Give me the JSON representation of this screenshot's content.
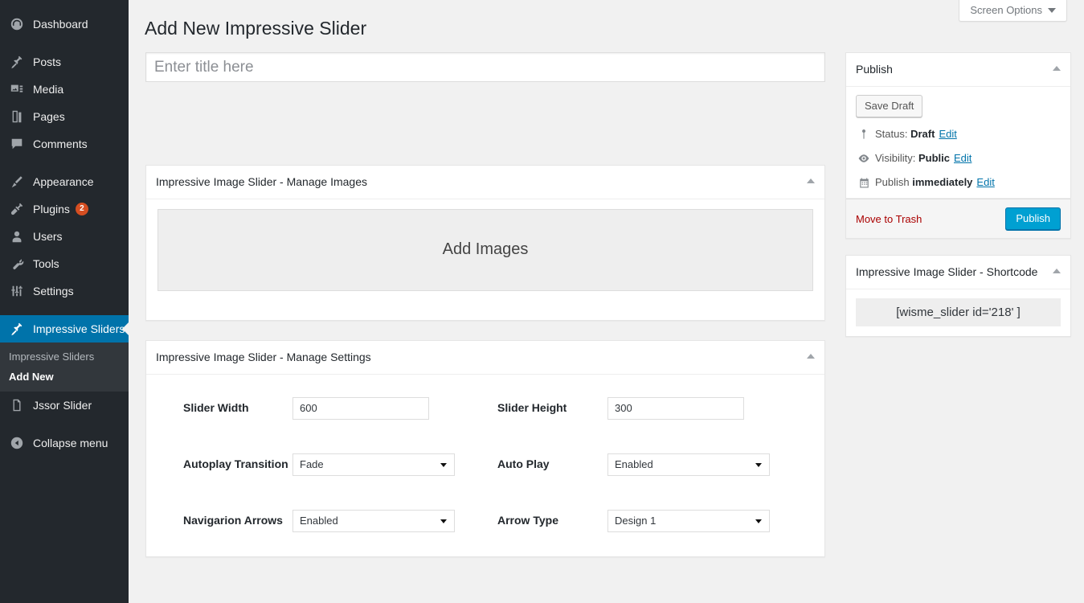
{
  "sidebar": {
    "items": [
      {
        "label": "Dashboard",
        "icon": "dashboard-icon",
        "name": "dashboard"
      },
      {
        "label": "Posts",
        "icon": "pin-icon",
        "name": "posts"
      },
      {
        "label": "Media",
        "icon": "media-icon",
        "name": "media"
      },
      {
        "label": "Pages",
        "icon": "pages-icon",
        "name": "pages"
      },
      {
        "label": "Comments",
        "icon": "comments-icon",
        "name": "comments"
      },
      {
        "label": "Appearance",
        "icon": "brush-icon",
        "name": "appearance"
      },
      {
        "label": "Plugins",
        "icon": "plug-icon",
        "name": "plugins",
        "badge": "2"
      },
      {
        "label": "Users",
        "icon": "user-icon",
        "name": "users"
      },
      {
        "label": "Tools",
        "icon": "wrench-icon",
        "name": "tools"
      },
      {
        "label": "Settings",
        "icon": "sliders-icon",
        "name": "settings"
      },
      {
        "label": "Impressive Sliders",
        "icon": "pin-icon",
        "name": "impressive-sliders",
        "current": true
      },
      {
        "label": "Jssor Slider",
        "icon": "document-icon",
        "name": "jssor-slider"
      },
      {
        "label": "Collapse menu",
        "icon": "collapse-icon",
        "name": "collapse-menu"
      }
    ],
    "submenu": [
      {
        "label": "Impressive Sliders",
        "name": "impressive-sliders"
      },
      {
        "label": "Add New",
        "name": "add-new",
        "current": true
      }
    ],
    "colors": {
      "background": "#23282d",
      "submenu_background": "#32373c",
      "active": "#0073aa",
      "badge": "#d54e21"
    }
  },
  "screen_options": {
    "label": "Screen Options"
  },
  "page": {
    "title": "Add New Impressive Slider"
  },
  "title_field": {
    "value": "",
    "placeholder": "Enter title here"
  },
  "images_panel": {
    "heading": "Impressive Image Slider - Manage Images",
    "add_images_label": "Add Images"
  },
  "settings_panel": {
    "heading": "Impressive Image Slider - Manage Settings",
    "rows": [
      {
        "left": {
          "label": "Slider Width",
          "type": "text",
          "value": "600"
        },
        "right": {
          "label": "Slider Height",
          "type": "text",
          "value": "300"
        }
      },
      {
        "left": {
          "label": "Autoplay Transition",
          "type": "select",
          "value": "Fade"
        },
        "right": {
          "label": "Auto Play",
          "type": "select",
          "value": "Enabled"
        }
      },
      {
        "left": {
          "label": "Navigarion Arrows",
          "type": "select",
          "value": "Enabled"
        },
        "right": {
          "label": "Arrow Type",
          "type": "select",
          "value": "Design 1"
        }
      }
    ]
  },
  "publish_box": {
    "heading": "Publish",
    "save_draft_label": "Save Draft",
    "status_prefix": "Status:",
    "status_value": "Draft",
    "visibility_prefix": "Visibility:",
    "visibility_value": "Public",
    "schedule_prefix": "Publish",
    "schedule_value": "immediately",
    "edit_label": "Edit",
    "trash_label": "Move to Trash",
    "publish_label": "Publish",
    "colors": {
      "publish_button": "#00a0d2",
      "trash_link": "#a00",
      "edit_link": "#0073aa"
    }
  },
  "shortcode_box": {
    "heading": "Impressive Image Slider - Shortcode",
    "value": "[wisme_slider id='218' ]"
  }
}
